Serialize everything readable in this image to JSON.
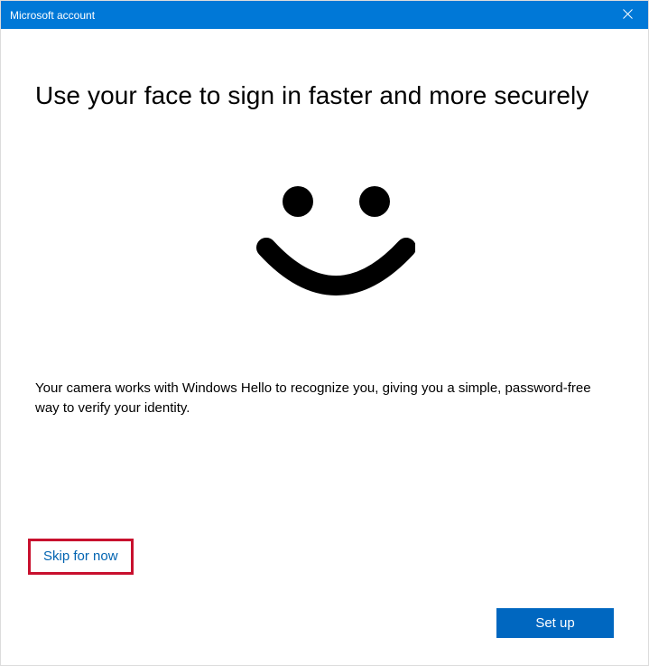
{
  "titlebar": {
    "title": "Microsoft account"
  },
  "main": {
    "heading": "Use your face to sign in faster and more securely",
    "description": "Your camera works with Windows Hello to recognize you, giving you a simple, password-free way to verify your identity."
  },
  "actions": {
    "skip_label": "Skip for now",
    "setup_label": "Set up"
  },
  "colors": {
    "accent": "#0078d7",
    "button_primary": "#0067c0",
    "highlight_border": "#c8102e",
    "link": "#0063b1"
  }
}
